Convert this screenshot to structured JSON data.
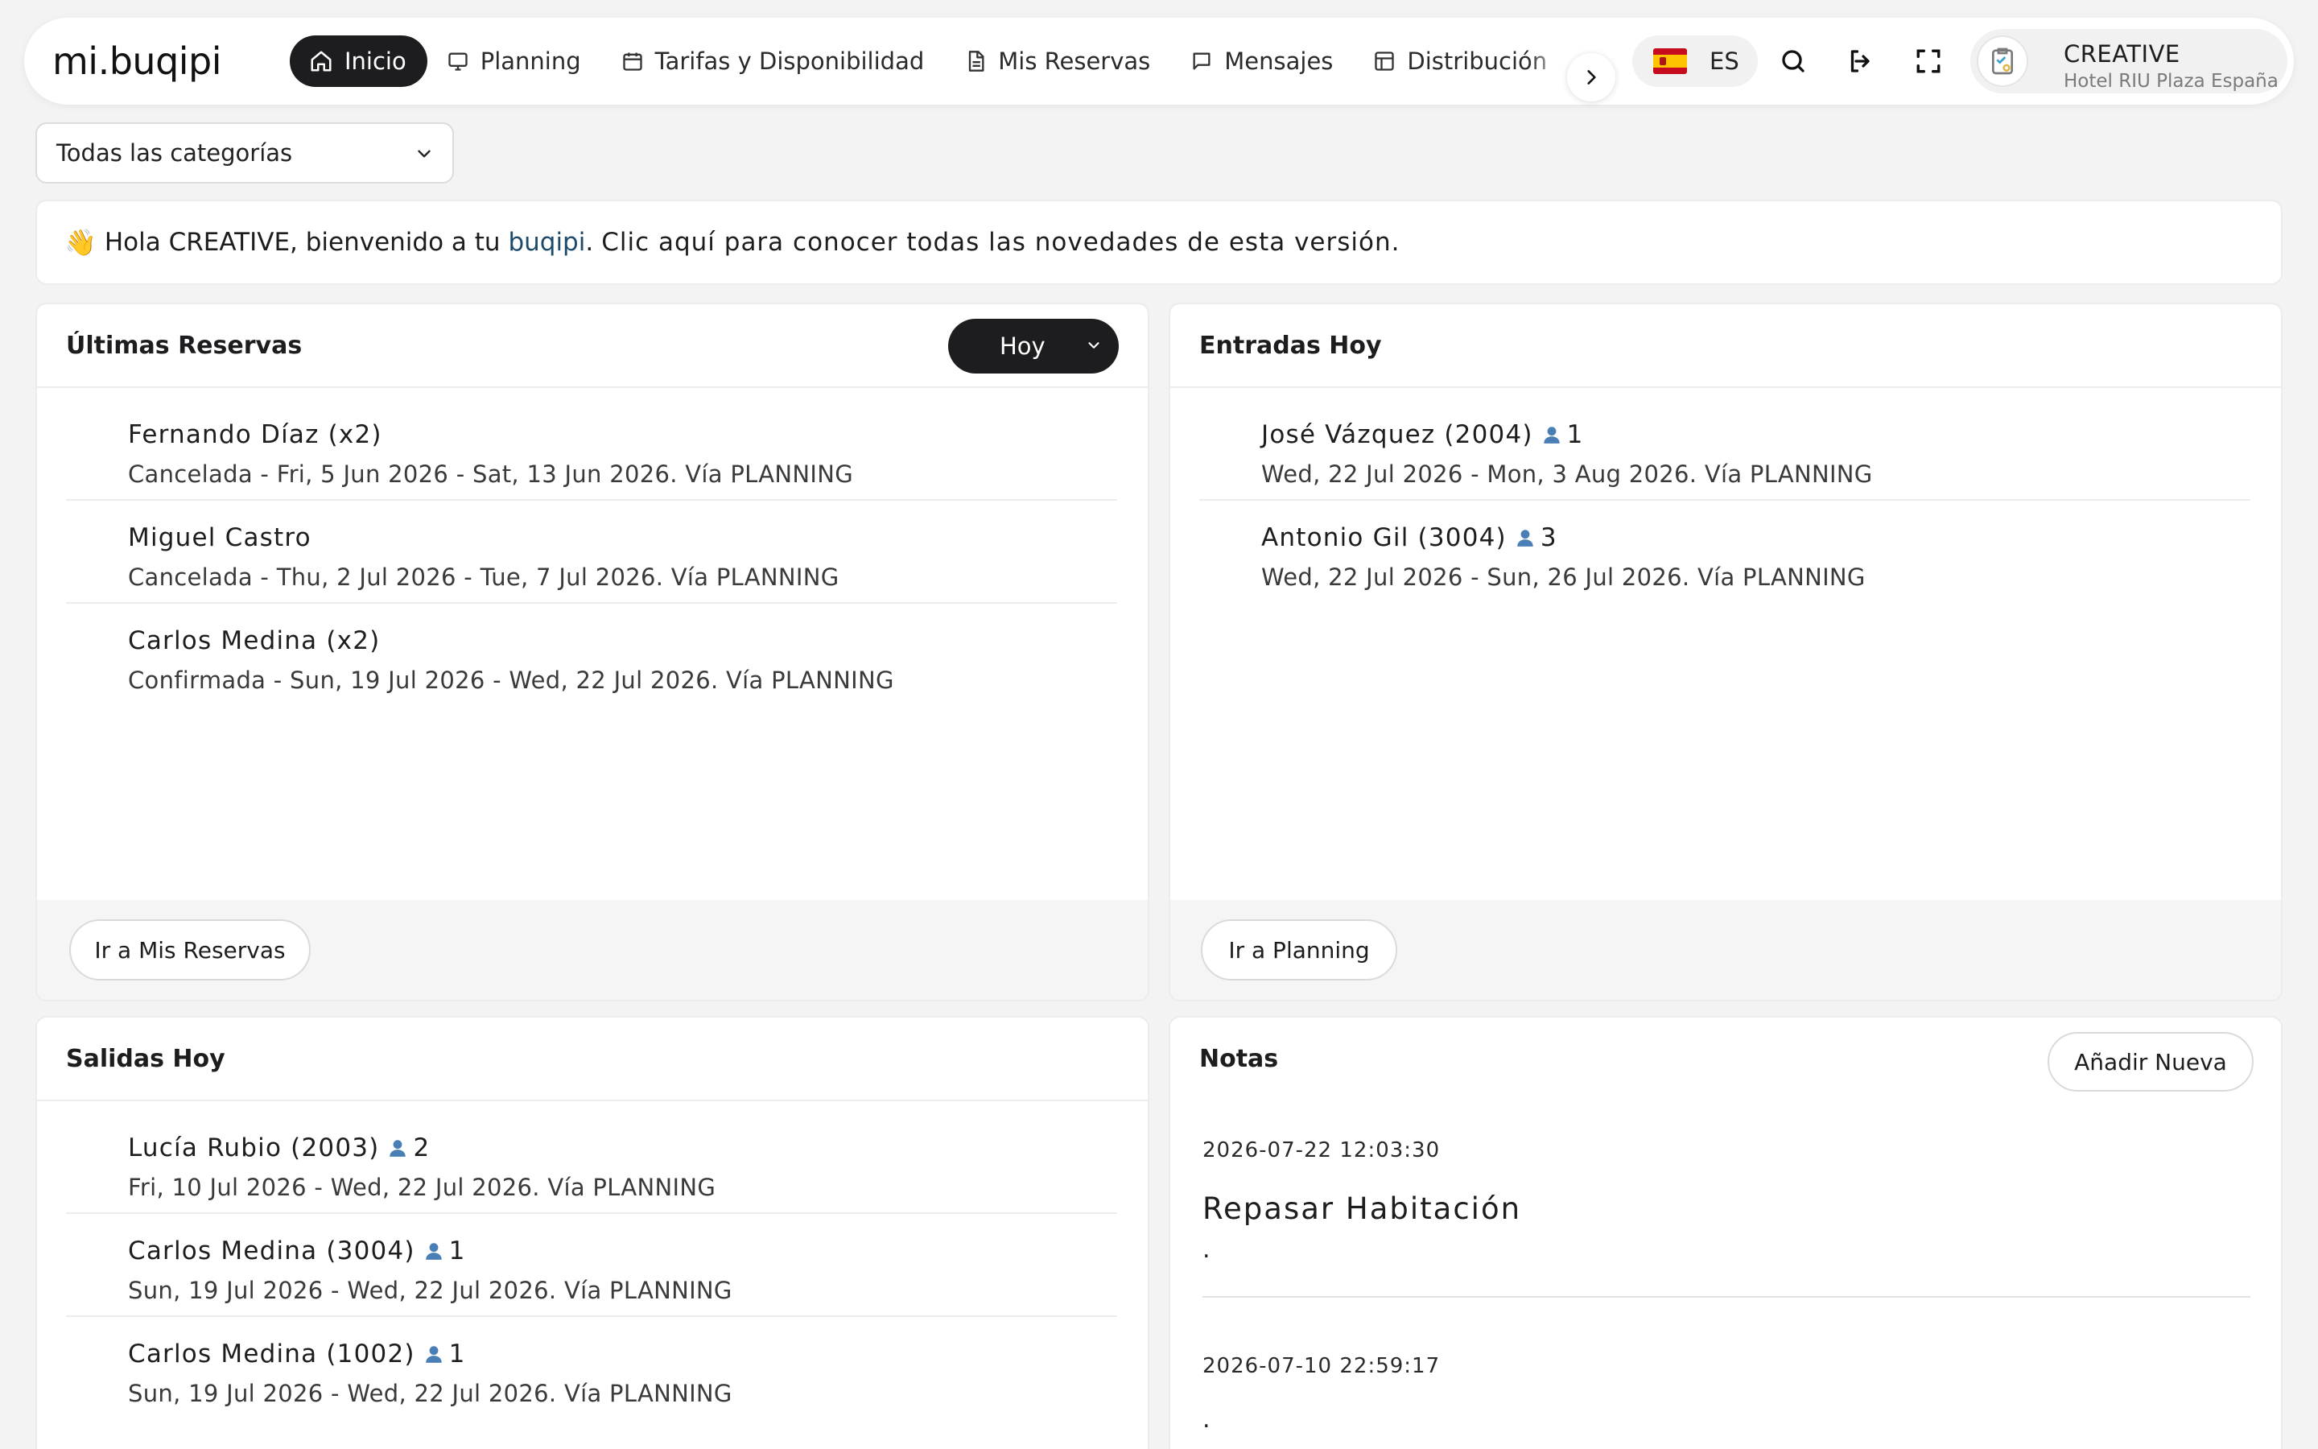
{
  "logo": "mi.buqipi",
  "nav": [
    {
      "label": "Inicio",
      "icon": "home-icon",
      "active": true
    },
    {
      "label": "Planning",
      "icon": "monitor-icon",
      "active": false
    },
    {
      "label": "Tarifas y Disponibilidad",
      "icon": "calendar-icon",
      "active": false
    },
    {
      "label": "Mis Reservas",
      "icon": "document-icon",
      "active": false
    },
    {
      "label": "Mensajes",
      "icon": "message-icon",
      "active": false
    },
    {
      "label": "Distribución",
      "icon": "layout-icon",
      "active": false
    }
  ],
  "language": {
    "code": "ES",
    "flag": "spain-flag-icon"
  },
  "user": {
    "name": "CREATIVE",
    "hotel": "Hotel RIU Plaza España"
  },
  "category_select": {
    "value": "Todas las categorías"
  },
  "welcome": {
    "emoji": "👋",
    "greeting": "Hola CREATIVE, bienvenido a tu ",
    "brand": "buqipi",
    "period": ".",
    "link": "Clic aquí para conocer todas las novedades de esta versión."
  },
  "latest": {
    "title": "Últimas Reservas",
    "filter": "Hoy",
    "button": "Ir a Mis Reservas",
    "items": [
      {
        "name": "Fernando Díaz (x2)",
        "detail": "Cancelada - Fri, 5 Jun 2026 - Sat, 13 Jun 2026. Vía PLANNING"
      },
      {
        "name": "Miguel Castro",
        "detail": "Cancelada - Thu, 2 Jul 2026 - Tue, 7 Jul 2026. Vía PLANNING"
      },
      {
        "name": "Carlos Medina (x2)",
        "detail": "Confirmada - Sun, 19 Jul 2026 - Wed, 22 Jul 2026. Vía PLANNING"
      }
    ]
  },
  "arrivals": {
    "title": "Entradas Hoy",
    "button": "Ir a Planning",
    "items": [
      {
        "name": "José Vázquez (2004)",
        "guests": "1",
        "detail": "Wed, 22 Jul 2026 - Mon, 3 Aug 2026. Vía PLANNING"
      },
      {
        "name": "Antonio Gil (3004)",
        "guests": "3",
        "detail": "Wed, 22 Jul 2026 - Sun, 26 Jul 2026. Vía PLANNING"
      }
    ]
  },
  "departures": {
    "title": "Salidas Hoy",
    "items": [
      {
        "name": "Lucía Rubio (2003)",
        "guests": "2",
        "detail": "Fri, 10 Jul 2026 - Wed, 22 Jul 2026. Vía PLANNING"
      },
      {
        "name": "Carlos Medina (3004)",
        "guests": "1",
        "detail": "Sun, 19 Jul 2026 - Wed, 22 Jul 2026. Vía PLANNING"
      },
      {
        "name": "Carlos Medina (1002)",
        "guests": "1",
        "detail": "Sun, 19 Jul 2026 - Wed, 22 Jul 2026. Vía PLANNING"
      }
    ]
  },
  "notes": {
    "title": "Notas",
    "button": "Añadir Nueva",
    "items": [
      {
        "date": "2026-07-22 12:03:30",
        "title": "Repasar Habitación",
        "body": "."
      },
      {
        "date": "2026-07-10 22:59:17",
        "title": "",
        "body": "."
      }
    ]
  }
}
